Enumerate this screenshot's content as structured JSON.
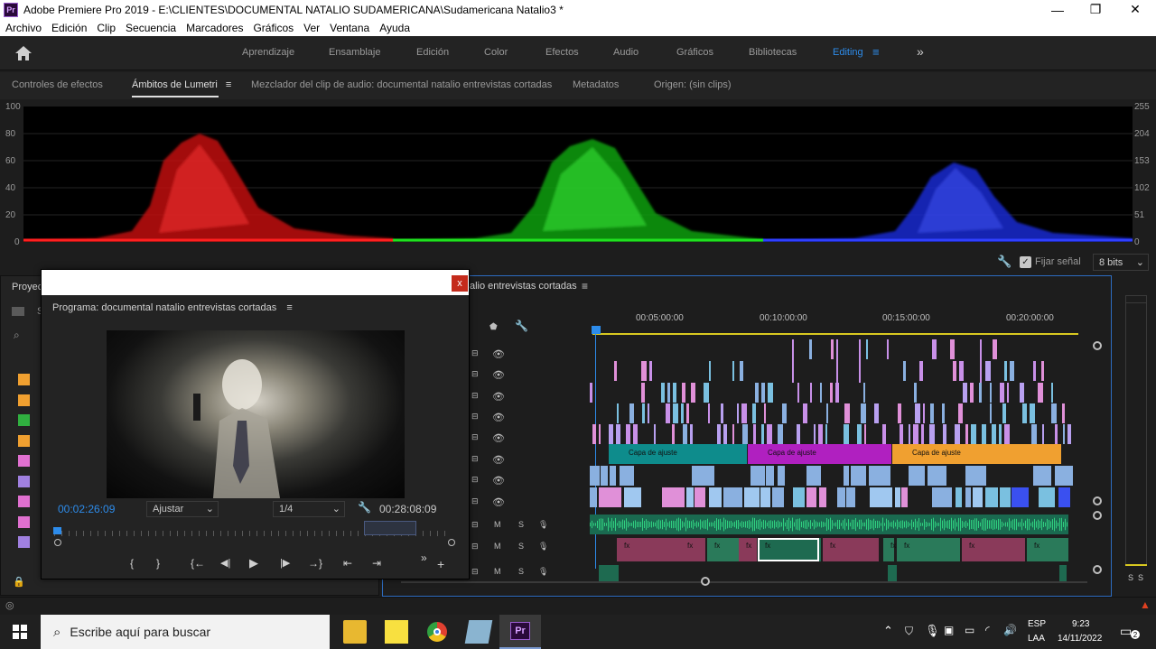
{
  "titlebar": {
    "app_badge": "Pr",
    "title": "Adobe Premiere Pro 2019 - E:\\CLIENTES\\DOCUMENTAL NATALIO SUDAMERICANA\\Sudamericana Natalio3 *",
    "minimize": "—",
    "restore": "❐",
    "close": "✕"
  },
  "menu": [
    "Archivo",
    "Edición",
    "Clip",
    "Secuencia",
    "Marcadores",
    "Gráficos",
    "Ver",
    "Ventana",
    "Ayuda"
  ],
  "workspaces": {
    "items": [
      "Aprendizaje",
      "Ensamblaje",
      "Edición",
      "Color",
      "Efectos",
      "Audio",
      "Gráficos",
      "Bibliotecas",
      "Editing"
    ],
    "active": "Editing",
    "more": "»",
    "menu_glyph": "≡"
  },
  "panel_tabs": [
    "Controles de efectos",
    "Ámbitos de Lumetri",
    "Mezclador del clip de audio: documental natalio entrevistas cortadas",
    "Metadatos",
    "Origen: (sin clips)"
  ],
  "scope": {
    "left_scale": [
      "100",
      "80",
      "60",
      "40",
      "20",
      "0"
    ],
    "right_scale": [
      "255",
      "204",
      "153",
      "102",
      "51",
      "0"
    ],
    "fijar_senal": "Fijar señal",
    "bit_depth": "8 bits",
    "colors": {
      "red": "#e01010",
      "green": "#10c010",
      "blue": "#1a2ee0"
    }
  },
  "project": {
    "tab_label": "Proyec",
    "folder_char": "S",
    "swatch_colors": [
      "#f0a030",
      "#f0a030",
      "#30b040",
      "#f0a030",
      "#e070d0",
      "#a080e0",
      "#e070d0",
      "#e070d0",
      "#a080e0"
    ]
  },
  "program": {
    "title": "Programa: documental natalio entrevistas cortadas",
    "menu_glyph": "≡",
    "timecode_current": "00:02:26:09",
    "fit": "Ajustar",
    "resolution": "1/4",
    "timecode_duration": "00:28:08:09",
    "close": "x",
    "controls": [
      "{",
      "}",
      "{←",
      "◀|",
      "▶",
      "|▶",
      "→}",
      "⇤",
      "⇥",
      "»",
      "+"
    ]
  },
  "timeline": {
    "title": "alio entrevistas cortadas",
    "menu_glyph": "≡",
    "ruler": [
      "00:05:00:00",
      "00:10:00:00",
      "00:15:00:00",
      "00:20:00:00"
    ],
    "adjust_clips": [
      {
        "label": "Capa de ajuste",
        "color": "#0e8c8c"
      },
      {
        "label": "Capa de ajuste",
        "color": "#b020c0"
      },
      {
        "label": "Capa de ajuste",
        "color": "#f0a030"
      }
    ],
    "audio_labels": {
      "mute": "M",
      "solo": "S"
    },
    "fx_label": "fx"
  },
  "audio_meter": {
    "solo_left": "S",
    "solo_right": "S"
  },
  "taskbar": {
    "search_placeholder": "Escribe aquí para buscar",
    "lang_top": "ESP",
    "lang_bottom": "LAA",
    "time": "9:23",
    "date": "14/11/2022",
    "notification_count": "2"
  }
}
